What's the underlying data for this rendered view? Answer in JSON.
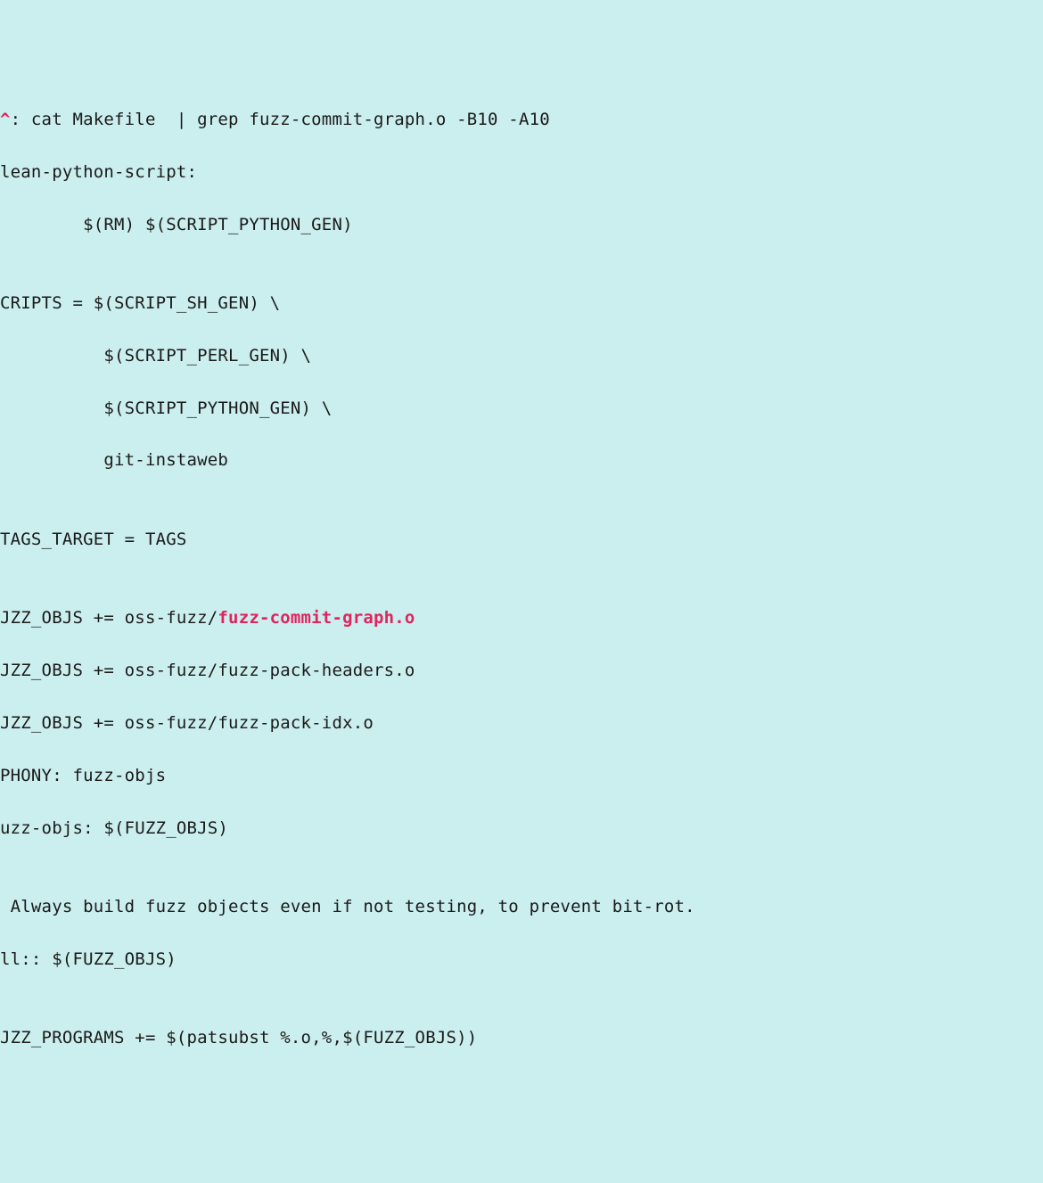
{
  "lines": {
    "l0a": "^",
    "l0b": ": cat Makefile  | grep fuzz-commit-graph.o -B10 -A10",
    "l1": "lean-python-script:",
    "l2": "        $(RM) $(SCRIPT_PYTHON_GEN)",
    "l3": "",
    "l4": "CRIPTS = $(SCRIPT_SH_GEN) \\",
    "l5": "          $(SCRIPT_PERL_GEN) \\",
    "l6": "          $(SCRIPT_PYTHON_GEN) \\",
    "l7": "          git-instaweb",
    "l8": "",
    "l9": "TAGS_TARGET = TAGS",
    "l10": "",
    "l11a": "JZZ_OBJS += oss-fuzz/",
    "l11b": "fuzz-commit-graph.o",
    "l12": "JZZ_OBJS += oss-fuzz/fuzz-pack-headers.o",
    "l13": "JZZ_OBJS += oss-fuzz/fuzz-pack-idx.o",
    "l14": "PHONY: fuzz-objs",
    "l15": "uzz-objs: $(FUZZ_OBJS)",
    "l16": "",
    "l17": " Always build fuzz objects even if not testing, to prevent bit-rot.",
    "l18": "ll:: $(FUZZ_OBJS)",
    "l19": "",
    "l20": "JZZ_PROGRAMS += $(patsubst %.o,%,$(FUZZ_OBJS))"
  }
}
